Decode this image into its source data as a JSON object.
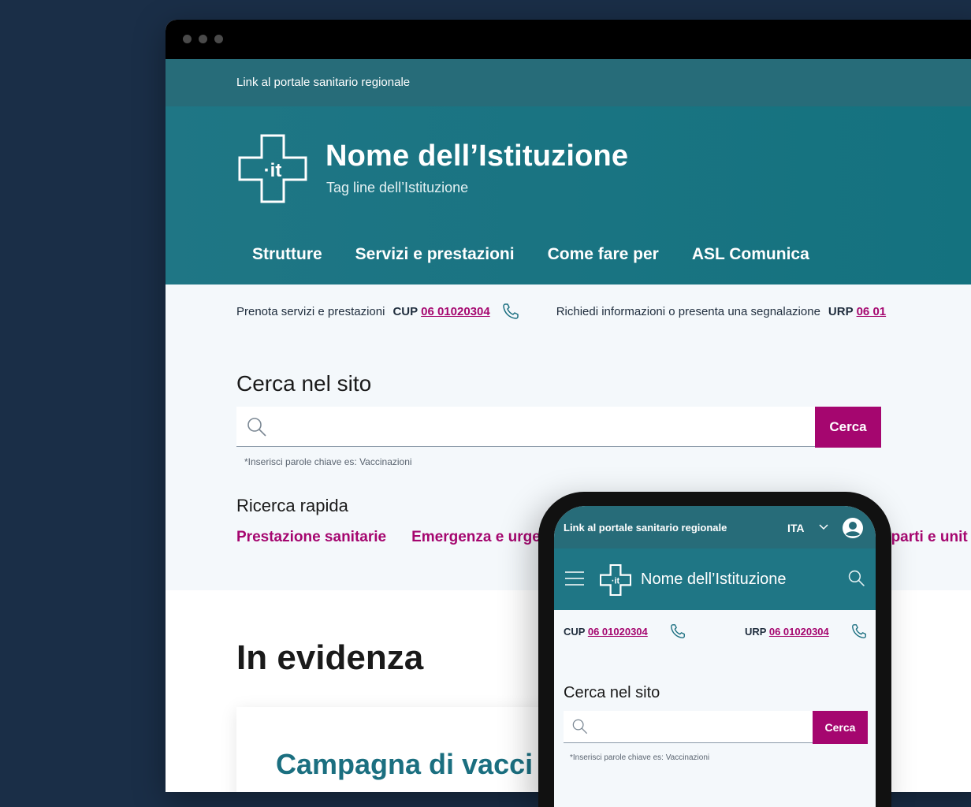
{
  "slim_header": {
    "link": "Link al portale sanitario regionale"
  },
  "header": {
    "name": "Nome dell’Istituzione",
    "tagline": "Tag line dell’Istituzione",
    "logo_text": "·it"
  },
  "nav": {
    "items": [
      {
        "label": "Strutture"
      },
      {
        "label": "Servizi e prestazioni"
      },
      {
        "label": "Come fare per"
      },
      {
        "label": "ASL Comunica"
      }
    ]
  },
  "contact_bar": {
    "cup_text": "Prenota servizi e prestazioni",
    "cup_label": "CUP",
    "cup_number": "06 01020304",
    "urp_text": "Richiedi informazioni o presenta una segnalazione",
    "urp_label": "URP",
    "urp_number": "06 01"
  },
  "search": {
    "title": "Cerca nel sito",
    "button": "Cerca",
    "hint": "*Inserisci parole chiave es: Vaccinazioni"
  },
  "quick_search": {
    "title": "Ricerca rapida",
    "links": [
      {
        "label": "Prestazione sanitarie"
      },
      {
        "label": "Emergenza e urgen"
      }
    ],
    "partial_link": "eparti e unit"
  },
  "highlights": {
    "title": "In evidenza",
    "card_title": "Campagna di vacci"
  },
  "mobile": {
    "slim_link": "Link al portale sanitario regionale",
    "language": "ITA",
    "name": "Nome dell’Istituzione",
    "cup_label": "CUP",
    "cup_number": "06 01020304",
    "urp_label": "URP",
    "urp_number": "06 01020304",
    "search_title": "Cerca nel sito",
    "search_button": "Cerca",
    "search_hint": "*Inserisci parole chiave es: Vaccinazioni"
  },
  "colors": {
    "page_bg": "#1a2e47",
    "brand_teal": "#1f7685",
    "slim_teal": "#276c79",
    "accent_magenta": "#a5066f",
    "light_bg": "#f4f8fb"
  }
}
